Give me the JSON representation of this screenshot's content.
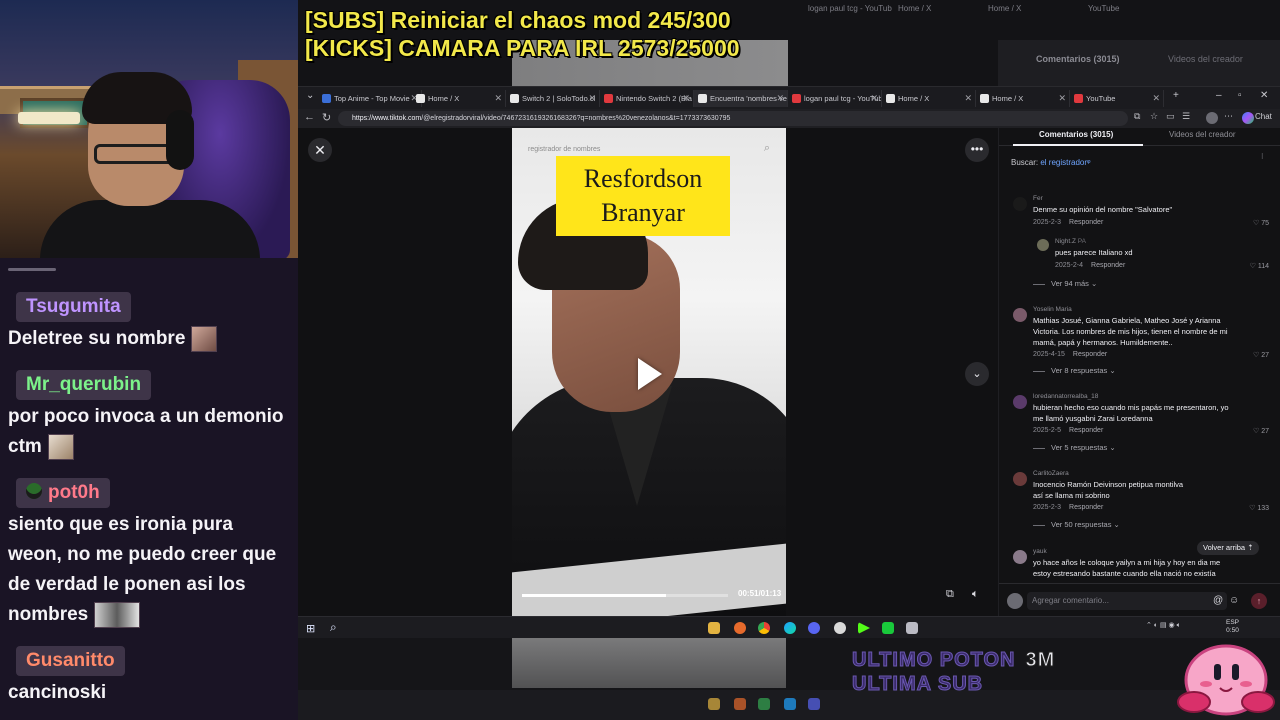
{
  "overlay": {
    "line1": "[SUBS] Reiniciar el chaos mod 245/300",
    "line2": "[KICKS] CAMARA PARA IRL 2573/25000"
  },
  "chat": {
    "messages": [
      {
        "user": "Tsugumita",
        "color": "#bf94ff",
        "text": "Deletree su nombre"
      },
      {
        "user": "Mr_querubin",
        "color": "#7cf28a",
        "text": "por poco invoca a un demonio ctm"
      },
      {
        "user": "pot0h",
        "color": "#ff7a8a",
        "text": "siento que es ironia pura weon, no me puedo creer que de verdad le ponen asi los nombres"
      },
      {
        "user": "Gusanitto",
        "color": "#ff8a6a",
        "text": "cancinoski"
      }
    ]
  },
  "ghost": {
    "tabs": [
      "logan paul tcg - YouTub",
      "Home / X",
      "Home / X",
      "YouTube"
    ],
    "comments_tab": "Comentarios (3015)",
    "videos_tab": "Videos del creador"
  },
  "browser": {
    "tabs": [
      {
        "label": "Top Anime - Top Movie",
        "color": "#3b6fd8"
      },
      {
        "label": "Home / X",
        "color": "#e8e8e8"
      },
      {
        "label": "Switch 2 | SoloTodo.cl",
        "color": "#e8e8e8"
      },
      {
        "label": "Nintendo Switch 2 (Bla",
        "color": "#e0393e"
      },
      {
        "label": "Encuentra 'nombres ven",
        "color": "#e8e8e8"
      },
      {
        "label": "logan paul tcg - YouTub",
        "color": "#e0393e"
      },
      {
        "label": "Home / X",
        "color": "#e8e8e8"
      },
      {
        "label": "Home / X",
        "color": "#e8e8e8"
      },
      {
        "label": "YouTube",
        "color": "#e0393e"
      }
    ],
    "url_domain": "https://www.tiktok.com",
    "url_path": "/@elregistradorviral/video/7467231619326168326?q=nombres%20venezolanos&t=1773373630795",
    "chat_label": "Chat"
  },
  "video": {
    "watermark": "registrador de nombres",
    "name_line1": "Resfordson",
    "name_line2": "Branyar",
    "progress": 0.7,
    "timecode": "00:51/01:13"
  },
  "comments": {
    "tab_comments": "Comentarios (3015)",
    "tab_videos": "Videos del creador",
    "search_label": "Buscar:",
    "search_query": "el registrador",
    "reply_label": "Responder",
    "items": [
      {
        "user": "Fer",
        "text": [
          "Denme su opinión del nombre \"Salvatore\""
        ],
        "date": "2025-2-3",
        "likes": "75",
        "avatar": "#1a1a1a"
      },
      {
        "user": "Night.Z",
        "text": [
          "pues parece Italiano xd"
        ],
        "date": "2025-2-4",
        "likes": "114",
        "avatar": "#6c6c58"
      },
      {
        "user": "Yoselin Maria",
        "text": [
          "Mathias Josué, Gianna Gabriela, Matheo José y Arianna",
          "Victoria. Los nombres de mis hijos, tienen el nombre de mi",
          "mamá, papá y hermanos. Humildemente.."
        ],
        "date": "2025-4-15",
        "likes": "27",
        "avatar": "#7a5a6a"
      },
      {
        "user": "loredannatorrealba_18",
        "text": [
          "hubieran hecho eso cuando mis papás me presentaron, yo",
          "me llamó yusgabni Zarai Loredanna"
        ],
        "date": "2025-2-5",
        "likes": "27",
        "avatar": "#5a3a6a"
      },
      {
        "user": "CarlitoZaera",
        "text": [
          "Inocencio Ramón Deivinson petipua montilva",
          "así se llama mi sobrino"
        ],
        "date": "2025-2-3",
        "likes": "133",
        "avatar": "#6a3a3a"
      },
      {
        "user": "yauk",
        "text": [
          "yo hace años le coloque yailyn a mi hija y hoy en dia me",
          "estoy estresando bastante cuando ella nació no existía"
        ],
        "date": "",
        "likes": "",
        "avatar": "#8a7a8a"
      }
    ],
    "view_more": [
      "Ver 94 más",
      "Ver 8 respuestas",
      "Ver 5 respuestas",
      "Ver 50 respuestas"
    ],
    "back_to_top": "Volver arriba",
    "add_placeholder": "Agregar comentario..."
  },
  "taskbar": {
    "lang": "ESP",
    "time": "0:50"
  },
  "stream_overlay": {
    "line1": "ULTIMO POTON",
    "line2": "ULTIMA SUB",
    "emote": "3M"
  }
}
